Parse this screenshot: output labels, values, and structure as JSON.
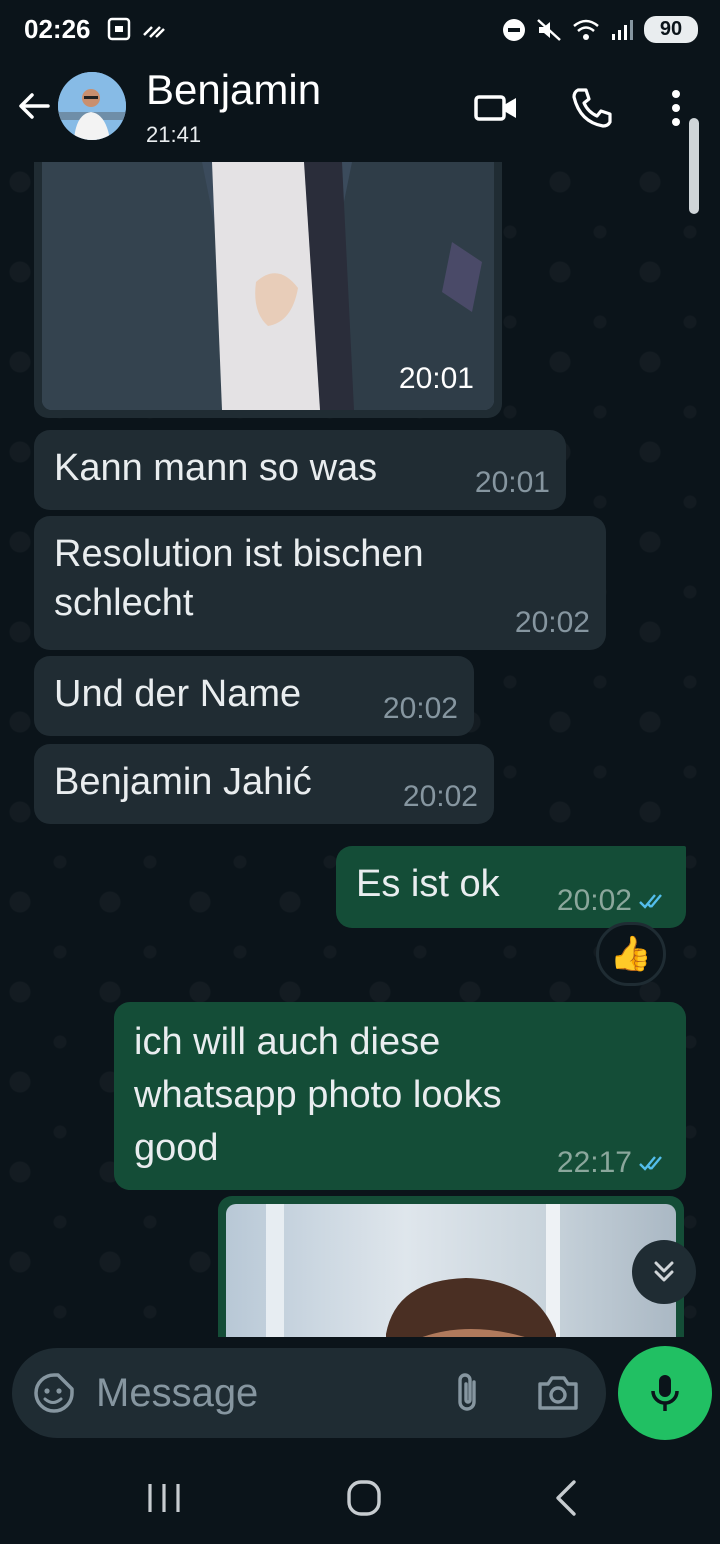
{
  "status_bar": {
    "time": "02:26",
    "battery": "90"
  },
  "header": {
    "contact_name": "Benjamin",
    "last_seen": "21:41"
  },
  "messages": [
    {
      "type": "photo_in",
      "time": "20:01"
    },
    {
      "type": "text_in",
      "text": "Kann mann so was",
      "time": "20:01"
    },
    {
      "type": "text_in",
      "text": "Resolution ist bischen\nschlecht",
      "time": "20:02"
    },
    {
      "type": "text_in",
      "text": "Und der Name",
      "time": "20:02"
    },
    {
      "type": "text_in",
      "text": "Benjamin Jahić",
      "time": "20:02"
    },
    {
      "type": "text_out",
      "text": "Es ist ok",
      "time": "20:02",
      "status": "read",
      "reaction": "👍"
    },
    {
      "type": "text_out",
      "text": "ich will auch diese\nwhatsapp photo looks\ngood",
      "time": "22:17",
      "status": "read"
    },
    {
      "type": "photo_out"
    }
  ],
  "composer": {
    "placeholder": "Message"
  },
  "colors": {
    "background": "#0b141a",
    "incoming_bubble": "#202c33",
    "outgoing_bubble": "#144d37",
    "read_ticks": "#53bdeb",
    "mic_button": "#21c063"
  },
  "icons": [
    "back-arrow-icon",
    "video-call-icon",
    "phone-icon",
    "more-options-icon",
    "sticker-icon",
    "attach-icon",
    "camera-icon",
    "microphone-icon",
    "scroll-down-icon",
    "recent-apps-icon",
    "home-icon",
    "nav-back-icon"
  ]
}
